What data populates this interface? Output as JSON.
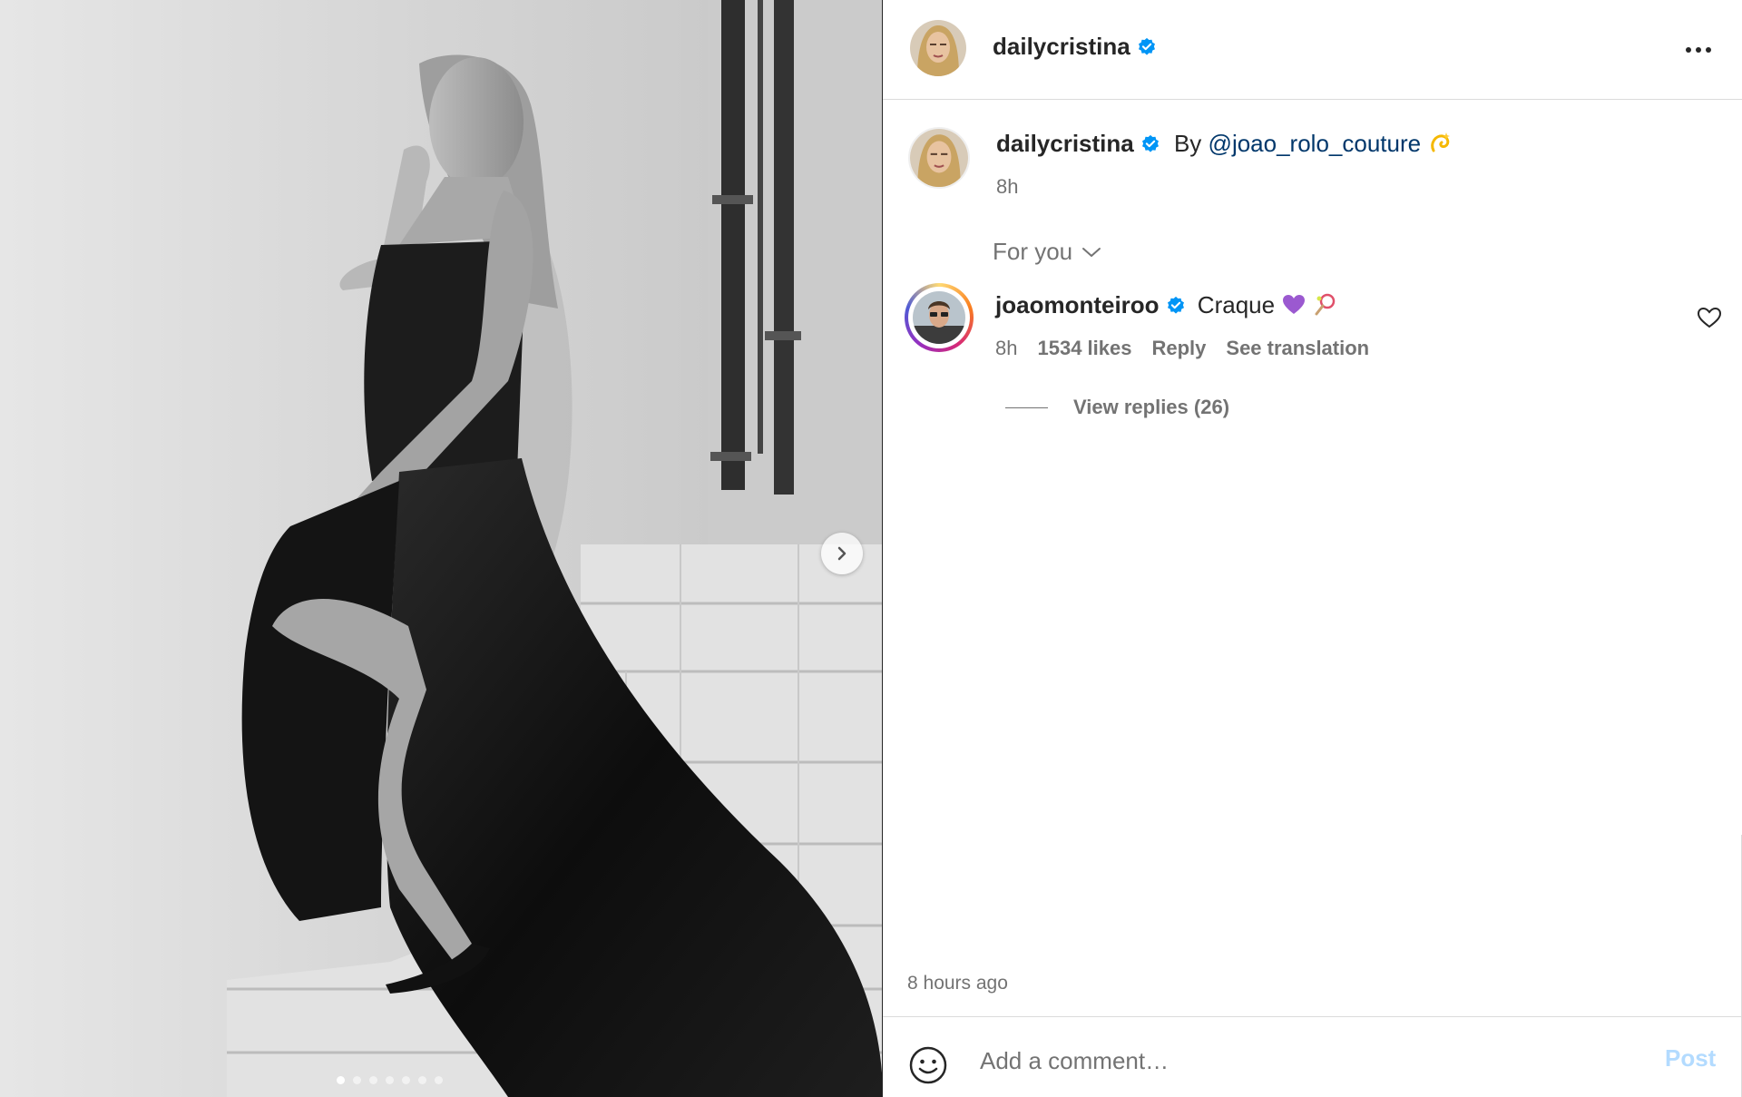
{
  "header": {
    "username": "dailycristina",
    "verified": true,
    "more_icon": "more-horizontal-icon"
  },
  "post": {
    "carousel": {
      "slide_count": 7,
      "current_slide": 1,
      "next_icon": "chevron-right-icon"
    },
    "caption": {
      "username": "dailycristina",
      "text_prefix": "By ",
      "mention": "@joao_rolo_couture",
      "emoji": "dizzy-emoji",
      "time": "8h"
    },
    "filter": {
      "label": "For you",
      "icon": "chevron-down-icon"
    },
    "comments": [
      {
        "username": "joaomonteiroo",
        "verified": true,
        "text": "Craque",
        "emojis": [
          "purple-heart-emoji",
          "tennis-racket-emoji"
        ],
        "time": "8h",
        "likes": "1534 likes",
        "reply_label": "Reply",
        "translate_label": "See translation",
        "view_replies": "View replies (26)"
      }
    ],
    "timestamp": "8 hours ago"
  },
  "compose": {
    "placeholder": "Add a comment…",
    "post_label": "Post",
    "emoji_icon": "smiley-icon"
  },
  "colors": {
    "verified_blue": "#0095f6",
    "mention_blue": "#00376b",
    "post_disabled": "#b3dbff",
    "secondary_text": "#737373"
  }
}
